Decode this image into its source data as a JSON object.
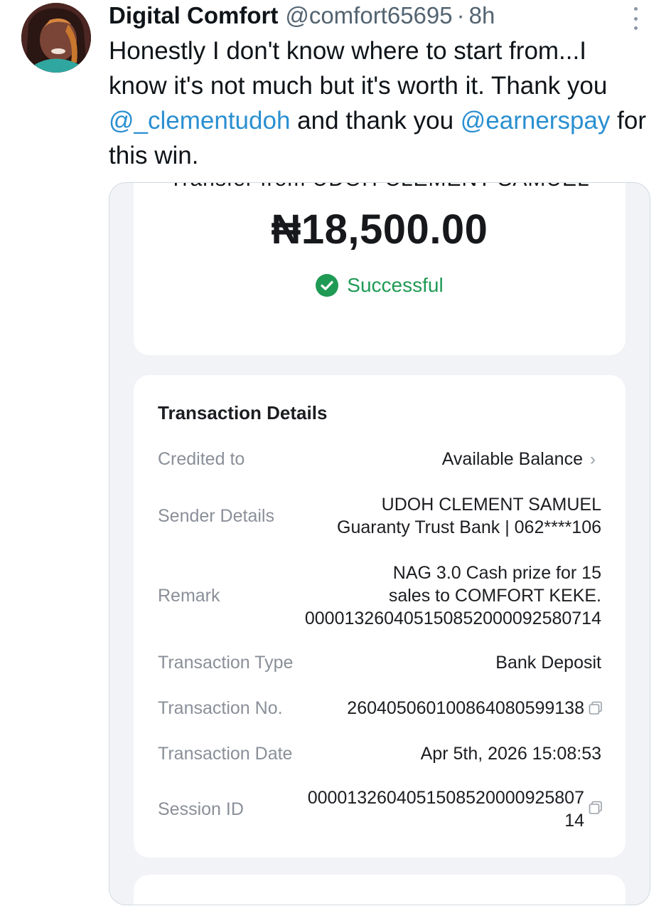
{
  "tweet": {
    "author_name": "Digital Comfort",
    "handle": "@comfort65695",
    "separator": "·",
    "time": "8h",
    "text_part1": "Honestly I don't know where to start from...I know it's not much but it's worth it. Thank you ",
    "mention1": "@_clementudoh",
    "text_part2": " and thank you ",
    "mention2": "@earnerspay",
    "text_part3": " for this win."
  },
  "receipt": {
    "cut_heading": "Transfer from UDOH CLEMENT SAMUEL",
    "amount": "₦18,500.00",
    "status": "Successful",
    "details_title": "Transaction Details",
    "rows": {
      "credited_to": {
        "label": "Credited to",
        "value": "Available Balance"
      },
      "sender": {
        "label": "Sender Details",
        "line1": "UDOH CLEMENT SAMUEL",
        "line2": "Guaranty Trust Bank | 062****106"
      },
      "remark": {
        "label": "Remark",
        "line1": "NAG 3.0 Cash prize for 15",
        "line2": "sales to COMFORT KEKE.",
        "line3": "000013260405150852000092580714"
      },
      "type": {
        "label": "Transaction Type",
        "value": "Bank Deposit"
      },
      "number": {
        "label": "Transaction No.",
        "value": "260405060100864080599138"
      },
      "date": {
        "label": "Transaction Date",
        "value": "Apr 5th, 2026 15:08:53"
      },
      "session": {
        "label": "Session ID",
        "line1": "000013260405150852000092580714",
        "line1a": "0000132604051508520000925807",
        "line2": "14"
      }
    }
  },
  "colors": {
    "success": "#1f9a55",
    "mention": "#2a8fd1",
    "muted": "#536471"
  },
  "icons": {
    "more": "more-vertical-icon",
    "status": "check-circle-icon",
    "copy": "copy-icon",
    "chevron": "chevron-right-icon"
  }
}
